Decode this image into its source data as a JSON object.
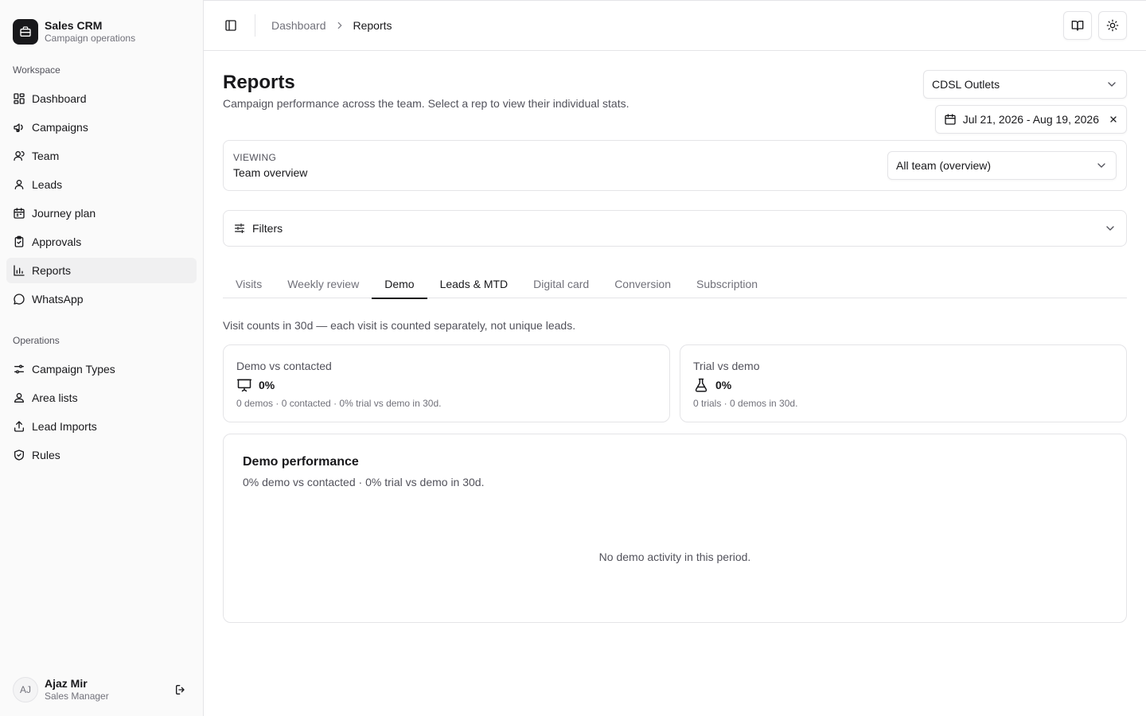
{
  "brand": {
    "name": "Sales CRM",
    "subtitle": "Campaign operations"
  },
  "sidebar": {
    "workspace_label": "Workspace",
    "workspace_items": [
      {
        "label": "Dashboard",
        "icon": "dashboard-icon"
      },
      {
        "label": "Campaigns",
        "icon": "megaphone-icon"
      },
      {
        "label": "Team",
        "icon": "users-icon"
      },
      {
        "label": "Leads",
        "icon": "user-icon"
      },
      {
        "label": "Journey plan",
        "icon": "calendar-icon"
      },
      {
        "label": "Approvals",
        "icon": "clipboard-check-icon"
      },
      {
        "label": "Reports",
        "icon": "bar-chart-icon",
        "active": true
      },
      {
        "label": "WhatsApp",
        "icon": "message-circle-icon"
      }
    ],
    "operations_label": "Operations",
    "operations_items": [
      {
        "label": "Campaign Types",
        "icon": "sliders-icon"
      },
      {
        "label": "Area lists",
        "icon": "user-group-icon"
      },
      {
        "label": "Lead Imports",
        "icon": "upload-icon"
      },
      {
        "label": "Rules",
        "icon": "shield-check-icon"
      }
    ]
  },
  "user": {
    "initials": "AJ",
    "name": "Ajaz Mir",
    "role": "Sales Manager"
  },
  "breadcrumb": {
    "parent": "Dashboard",
    "current": "Reports"
  },
  "page": {
    "title": "Reports",
    "description": "Campaign performance across the team. Select a rep to view their individual stats.",
    "outlet_select": "CDSL Outlets",
    "date_range": "Jul 21, 2026 - Aug 19, 2026"
  },
  "viewing": {
    "label": "VIEWING",
    "value": "Team overview",
    "select": "All team (overview)"
  },
  "filters": {
    "label": "Filters"
  },
  "tabs": [
    {
      "label": "Visits"
    },
    {
      "label": "Weekly review"
    },
    {
      "label": "Demo",
      "active": true
    },
    {
      "label": "Leads & MTD"
    },
    {
      "label": "Digital card"
    },
    {
      "label": "Conversion"
    },
    {
      "label": "Subscription"
    }
  ],
  "note": "Visit counts in 30d — each visit is counted separately, not unique leads.",
  "stats": [
    {
      "title": "Demo vs contacted",
      "value": "0%",
      "sub": "0 demos · 0 contacted · 0% trial vs demo in 30d.",
      "icon": "presentation-icon"
    },
    {
      "title": "Trial vs demo",
      "value": "0%",
      "sub": "0 trials · 0 demos in 30d.",
      "icon": "flask-icon"
    }
  ],
  "performance": {
    "title": "Demo performance",
    "subtitle": "0% demo vs contacted · 0% trial vs demo in 30d.",
    "empty": "No demo activity in this period."
  },
  "colors": {
    "accent": "#18181b",
    "border": "#e4e4e7",
    "muted": "#71717a",
    "sidebar_bg": "#fafafa"
  }
}
